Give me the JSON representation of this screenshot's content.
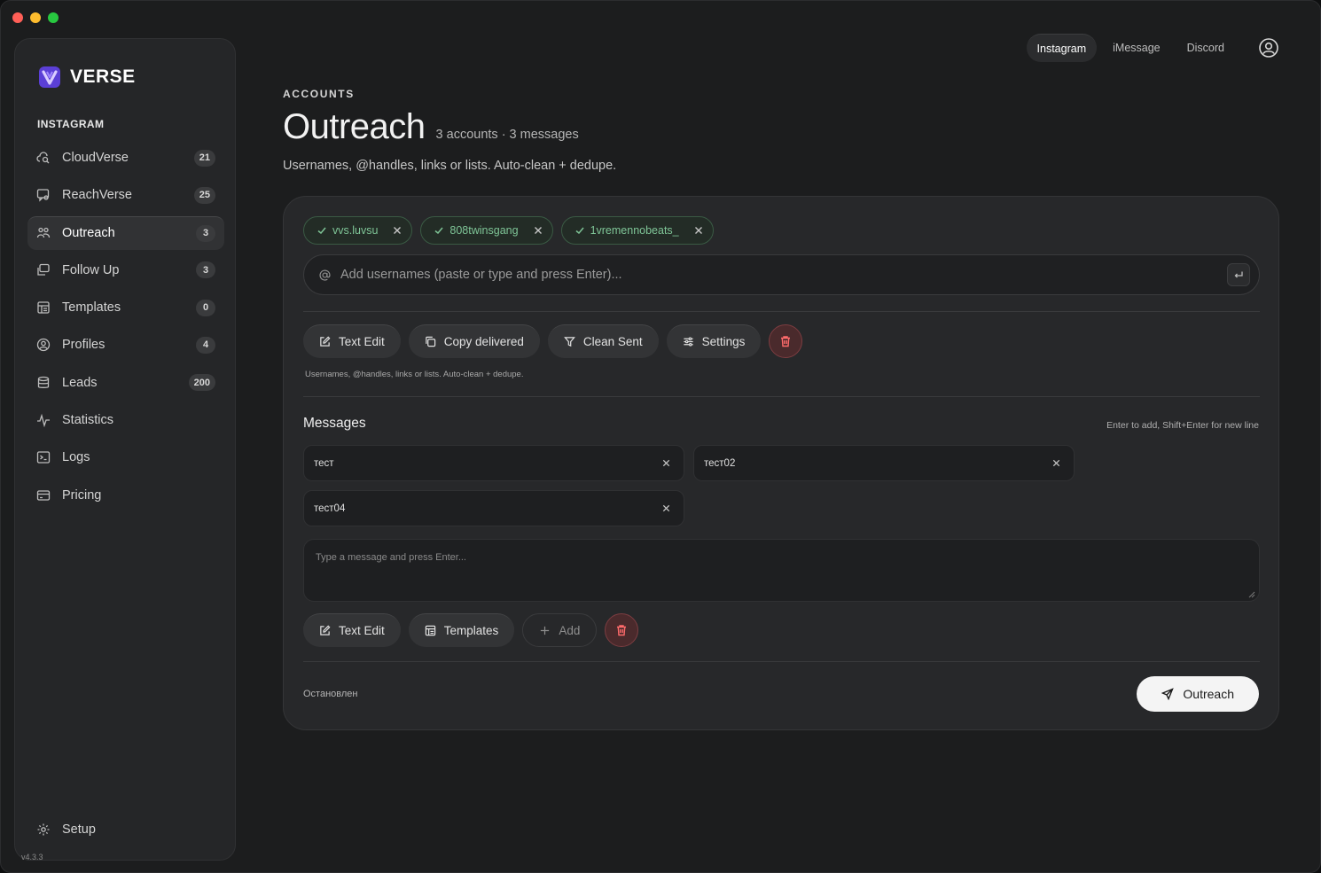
{
  "brand": {
    "name": "VERSE",
    "logo_icon": "verse-logo-icon",
    "accent": "#7b5cf0"
  },
  "sidebar": {
    "section": "INSTAGRAM",
    "items": [
      {
        "label": "CloudVerse",
        "badge": "21",
        "icon": "cloud-search-icon"
      },
      {
        "label": "ReachVerse",
        "badge": "25",
        "icon": "message-search-icon"
      },
      {
        "label": "Outreach",
        "badge": "3",
        "icon": "users-icon",
        "active": true
      },
      {
        "label": "Follow Up",
        "badge": "3",
        "icon": "follow-up-icon"
      },
      {
        "label": "Templates",
        "badge": "0",
        "icon": "template-icon"
      },
      {
        "label": "Profiles",
        "badge": "4",
        "icon": "profile-icon"
      },
      {
        "label": "Leads",
        "badge": "200",
        "icon": "database-icon"
      },
      {
        "label": "Statistics",
        "icon": "activity-icon"
      },
      {
        "label": "Logs",
        "icon": "terminal-icon"
      },
      {
        "label": "Pricing",
        "icon": "credit-card-icon"
      }
    ],
    "setup": "Setup",
    "version": "v4.3.3"
  },
  "topbar": {
    "tabs": [
      {
        "label": "Instagram",
        "active": true
      },
      {
        "label": "iMessage"
      },
      {
        "label": "Discord"
      }
    ]
  },
  "header": {
    "eyebrow": "ACCOUNTS",
    "title": "Outreach",
    "meta": "3 accounts · 3 messages",
    "subtitle": "Usernames, @handles, links or lists. Auto-clean + dedupe."
  },
  "accounts": {
    "chips": [
      "vvs.luvsu",
      "808twinsgang",
      "1vremennobeats_"
    ],
    "input_placeholder": "Add usernames (paste or type and press Enter)...",
    "actions": {
      "text_edit": "Text Edit",
      "copy_delivered": "Copy delivered",
      "clean_sent": "Clean Sent",
      "settings": "Settings"
    },
    "hint": "Usernames, @handles, links or lists. Auto-clean + dedupe."
  },
  "messages": {
    "title": "Messages",
    "hint": "Enter to add, Shift+Enter for new line",
    "items": [
      "тест",
      "тест02",
      "тест04"
    ],
    "textarea_placeholder": "Type a message and press Enter...",
    "actions": {
      "text_edit": "Text Edit",
      "templates": "Templates",
      "add": "Add"
    }
  },
  "footer": {
    "status": "Остановлен",
    "primary": "Outreach"
  },
  "colors": {
    "chip_green": "#7fc597",
    "danger": "#ff6b6b",
    "background": "#1c1d1e"
  }
}
